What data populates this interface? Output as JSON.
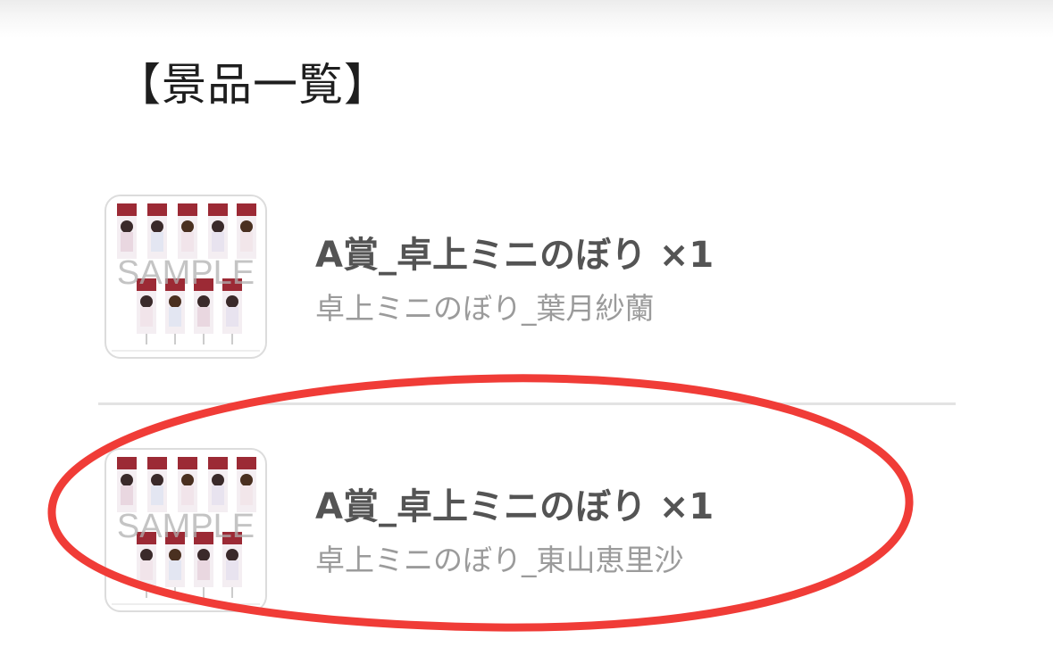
{
  "heading": "【景品一覧】",
  "prizes": [
    {
      "title": "A賞_卓上ミニのぼり ×1",
      "subtitle": "卓上ミニのぼり_葉月紗蘭",
      "thumbnail_watermark": "SAMPLE"
    },
    {
      "title": "A賞_卓上ミニのぼり ×1",
      "subtitle": "卓上ミニのぼり_東山恵里沙",
      "thumbnail_watermark": "SAMPLE"
    }
  ],
  "colors": {
    "highlight_ring": "#f03c37",
    "banner_red": "#9c2a35",
    "title_text": "#545454",
    "subtitle_text": "#9b9b9b"
  }
}
